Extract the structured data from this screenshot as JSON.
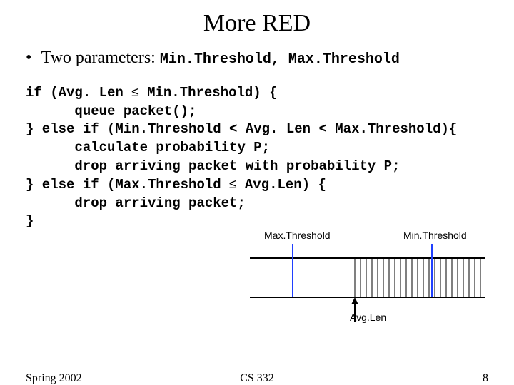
{
  "title": "More RED",
  "bullet_marker": "•",
  "bullet_text": "Two parameters: ",
  "bullet_code": "Min.Threshold, Max.Threshold",
  "code": {
    "l1": "if (Avg. Len ",
    "l1b": " Min.Threshold) {",
    "l2": "      queue_packet();",
    "l3": "} else if (Min.Threshold < Avg. Len < Max.Threshold){",
    "l4": "      calculate probability P;",
    "l5": "      drop arriving packet with probability P;",
    "l6": "} else if (Max.Threshold ",
    "l6b": " Avg.Len) {",
    "l7": "      drop arriving packet;",
    "l8": "}",
    "le": "≤"
  },
  "illustration": {
    "max_label": "Max.Threshold",
    "min_label": "Min.Threshold",
    "avg_label": "Avg.Len"
  },
  "footer": {
    "left": "Spring 2002",
    "center": "CS 332",
    "right": "8"
  }
}
